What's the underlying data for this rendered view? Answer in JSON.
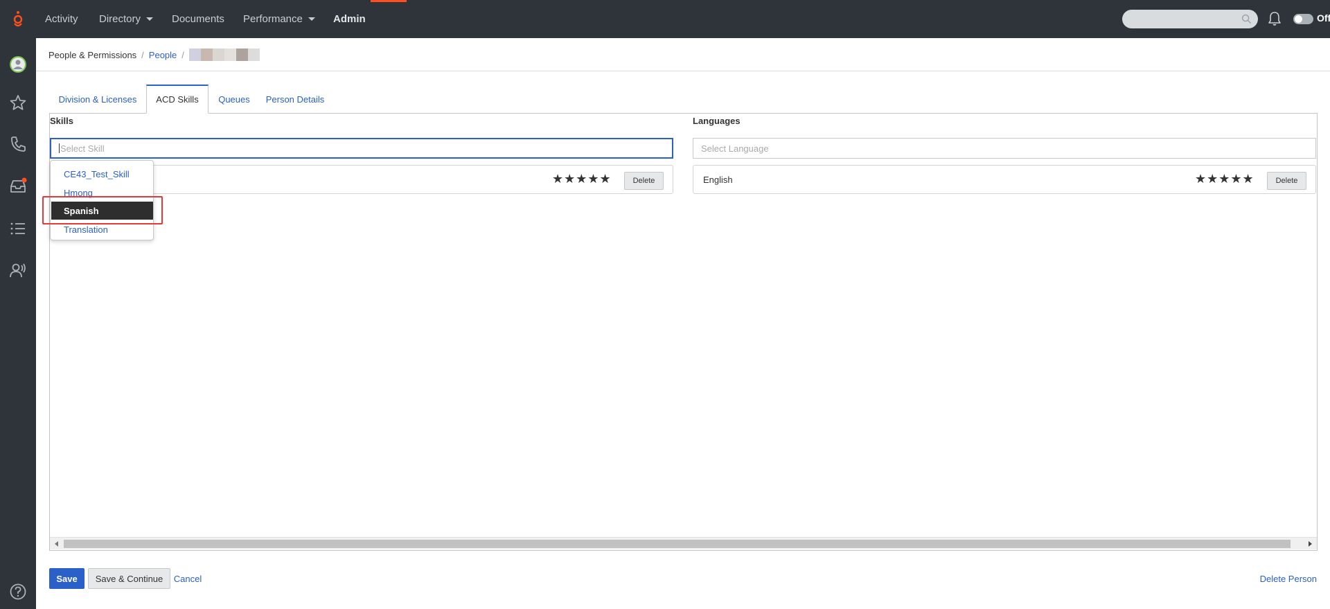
{
  "nav": {
    "items": [
      {
        "label": "Activity"
      },
      {
        "label": "Directory"
      },
      {
        "label": "Documents"
      },
      {
        "label": "Performance"
      },
      {
        "label": "Admin"
      }
    ],
    "queue_label": "Off Queue",
    "accent": "#ff4f1f"
  },
  "sidebar": {
    "icons": [
      "genesys-logo-icon",
      "avatar-icon",
      "star-icon",
      "phone-icon",
      "inbox-icon",
      "list-icon",
      "users-icon",
      "help-icon"
    ],
    "notification_color": "#ff4f1f"
  },
  "breadcrumb": {
    "root": "People & Permissions",
    "link": "People",
    "separator": "/"
  },
  "tabs": [
    {
      "label": "Division & Licenses"
    },
    {
      "label": "ACD Skills"
    },
    {
      "label": "Queues"
    },
    {
      "label": "Person Details"
    }
  ],
  "skills": {
    "title": "Skills",
    "placeholder": "Select Skill",
    "stars": "★★★★★",
    "delete_label": "Delete"
  },
  "languages": {
    "title": "Languages",
    "placeholder": "Select Language",
    "row_name": "English",
    "stars": "★★★★★",
    "delete_label": "Delete"
  },
  "dropdown": {
    "options": [
      {
        "label": "CE43_Test_Skill"
      },
      {
        "label": "Hmong"
      },
      {
        "label": "Spanish"
      },
      {
        "label": "Translation"
      }
    ],
    "selected": "Spanish"
  },
  "footer": {
    "save": "Save",
    "save_continue": "Save & Continue",
    "cancel": "Cancel",
    "delete_person": "Delete Person"
  }
}
